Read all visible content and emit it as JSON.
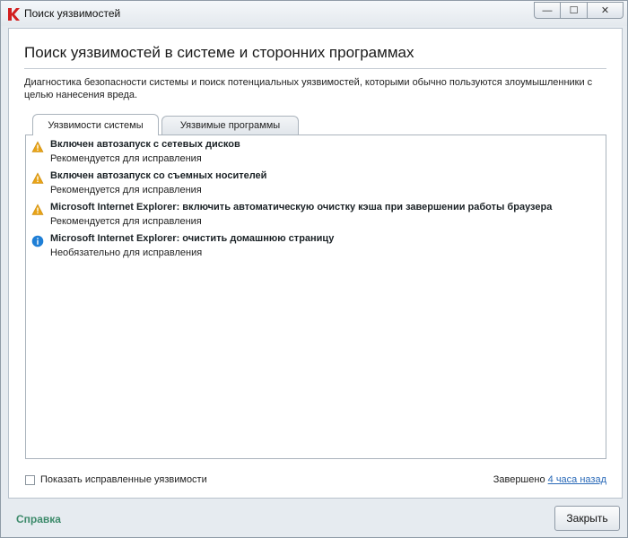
{
  "window": {
    "title": "Поиск уязвимостей",
    "minimize_glyph": "—",
    "maximize_glyph": "☐",
    "close_glyph": "✕"
  },
  "page": {
    "heading": "Поиск уязвимостей в системе и сторонних программах",
    "description": "Диагностика безопасности системы и поиск потенциальных уязвимостей, которыми обычно пользуются злоумышленники с целью нанесения вреда."
  },
  "tabs": [
    {
      "label": "Уязвимости системы",
      "active": true
    },
    {
      "label": "Уязвимые программы",
      "active": false
    }
  ],
  "items": [
    {
      "icon": "warning-icon",
      "title": "Включен автозапуск с сетевых дисков",
      "subtitle": "Рекомендуется для исправления"
    },
    {
      "icon": "warning-icon",
      "title": "Включен автозапуск со съемных носителей",
      "subtitle": "Рекомендуется для исправления"
    },
    {
      "icon": "warning-icon",
      "title": "Microsoft Internet Explorer: включить автоматическую очистку кэша при завершении работы браузера",
      "subtitle": "Рекомендуется для исправления"
    },
    {
      "icon": "info-icon",
      "title": "Microsoft Internet Explorer: очистить домашнюю страницу",
      "subtitle": "Необязательно для исправления"
    }
  ],
  "show_fixed": {
    "label": "Показать исправленные уязвимости",
    "checked": false
  },
  "status": {
    "prefix": "Завершено",
    "link": "4 часа назад"
  },
  "footer": {
    "help": "Справка",
    "close": "Закрыть"
  },
  "colors": {
    "warning": "#e8a317",
    "info": "#1f7fd6",
    "accent_green": "#3c8a6a",
    "link": "#2a6ab8"
  }
}
